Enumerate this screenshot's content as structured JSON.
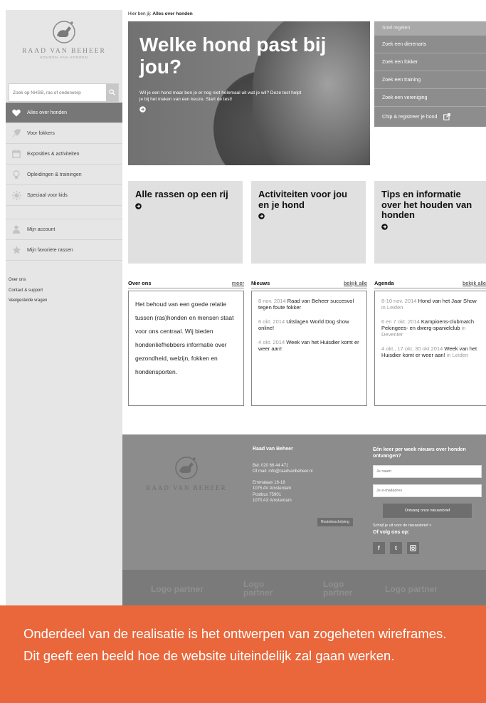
{
  "sidebar": {
    "logo": {
      "name": "RAAD VAN BEHEER",
      "tagline": "HOUDEN VAN HONDEN"
    },
    "search": {
      "placeholder": "Zoek op NHSB, ras of onderwerp"
    },
    "nav": [
      {
        "label": "Alles over honden",
        "icon": "heart-icon",
        "active": true
      },
      {
        "label": "Voor fokkers",
        "icon": "feather-icon",
        "active": false
      },
      {
        "label": "Exposities & activiteiten",
        "icon": "calendar-icon",
        "active": false
      },
      {
        "label": "Opleidingen & trainingen",
        "icon": "lightbulb-icon",
        "active": false
      },
      {
        "label": "Speciaal voor kids",
        "icon": "sun-icon",
        "active": false
      }
    ],
    "account": [
      {
        "label": "Mijn account",
        "icon": "user-icon"
      },
      {
        "label": "Mijn favoriete rassen",
        "icon": "star-icon"
      }
    ],
    "links": [
      "Over ons",
      "Contact & support",
      "Veelgestelde vragen"
    ]
  },
  "breadcrumb": {
    "prefix": "Hier ben jij: ",
    "current": "Alles over honden"
  },
  "hero": {
    "title": "Welke hond past bij jou?",
    "text": "Wil je een hond maar ben je er nog niet helemaal uit wat je wil? Deze test helpt je bij het maken van een keuze. Start de test!"
  },
  "quicklinks": {
    "heading": "Snel regelen",
    "items": [
      "Zoek een dierenarts",
      "Zoek een fokker",
      "Zoek een training",
      "Zoek een vereniging",
      "Chip & registreer je hond"
    ]
  },
  "tiles": [
    "Alle rassen op een rij",
    "Activiteiten voor jou en je hond",
    "Tips en informatie over het houden van honden"
  ],
  "about": {
    "title": "Over ons",
    "more": "meer",
    "text": "Het behoud van een goede relatie tussen (ras)honden en mensen staat voor ons centraal. Wij bieden hondenliefhebbers informatie over gezondheid, welzijn, fokken en hondensporten."
  },
  "news": {
    "title": "Nieuws",
    "more": "bekijk alle",
    "items": [
      {
        "date": "8 nov. 2014",
        "text": "Raad van Beheer succesvol tegen foute fokker"
      },
      {
        "date": "6 okt. 2014",
        "text": "Uitslagen World Dog show online!"
      },
      {
        "date": "4 okt. 2014",
        "text": "Week van het Huisdier komt er weer aan!"
      }
    ]
  },
  "agenda": {
    "title": "Agenda",
    "more": "bekijk alle",
    "items": [
      {
        "date": "8-10 nov. 2014",
        "text": "Hond van het Jaar Show",
        "place": "in Leiden"
      },
      {
        "date": "6 en 7 okt. 2014",
        "text": "Kampioens-clubmatch Pekingees- en dwerg-spanielclub",
        "place": "in Deventer"
      },
      {
        "date": "4 okt., 17 okt, 30 okt 2014",
        "text": "Week van het Huisdier komt er weer aan!",
        "place": "in Leiden"
      }
    ]
  },
  "footer": {
    "logo_name": "RAAD VAN BEHEER",
    "org": "Raad van Beheer",
    "phone": "Bel: 020 66 44 471",
    "mail": "Of mail: info@raadvanbeheer.nl",
    "address": [
      "Emmalaan 16-18",
      "1075 AV Amsterdam",
      "Postbus 75901",
      "1070 AX Amsterdam"
    ],
    "route": "Routebeschrijving",
    "newsletter": {
      "title": "Eén keer per week nieuws over honden ontvangen?",
      "name_placeholder": "Je naam",
      "email_placeholder": "Je e-mailadres",
      "button": "Ontvang onze nieuwsbrief",
      "unsubscribe": "Schrijf je uit voor de nieuwsbrief >",
      "follow": "Of volg ons op:",
      "social": [
        {
          "label": "f",
          "icon": "facebook-icon"
        },
        {
          "label": "t",
          "icon": "twitter-icon"
        },
        {
          "label": "i",
          "icon": "instagram-icon"
        }
      ]
    },
    "partners": [
      "Logo partner",
      "Logo partner",
      "Logo partner",
      "Logo partner"
    ]
  },
  "caption": "Onderdeel van de realisatie is het ontwerpen van zogeheten wireframes. Dit geeft een beeld hoe de website uiteindelijk zal gaan werken.",
  "colors": {
    "accent": "#e9673b",
    "sidebar": "#e6e6e6",
    "active": "#777777",
    "footer": "#8c8c8c"
  }
}
